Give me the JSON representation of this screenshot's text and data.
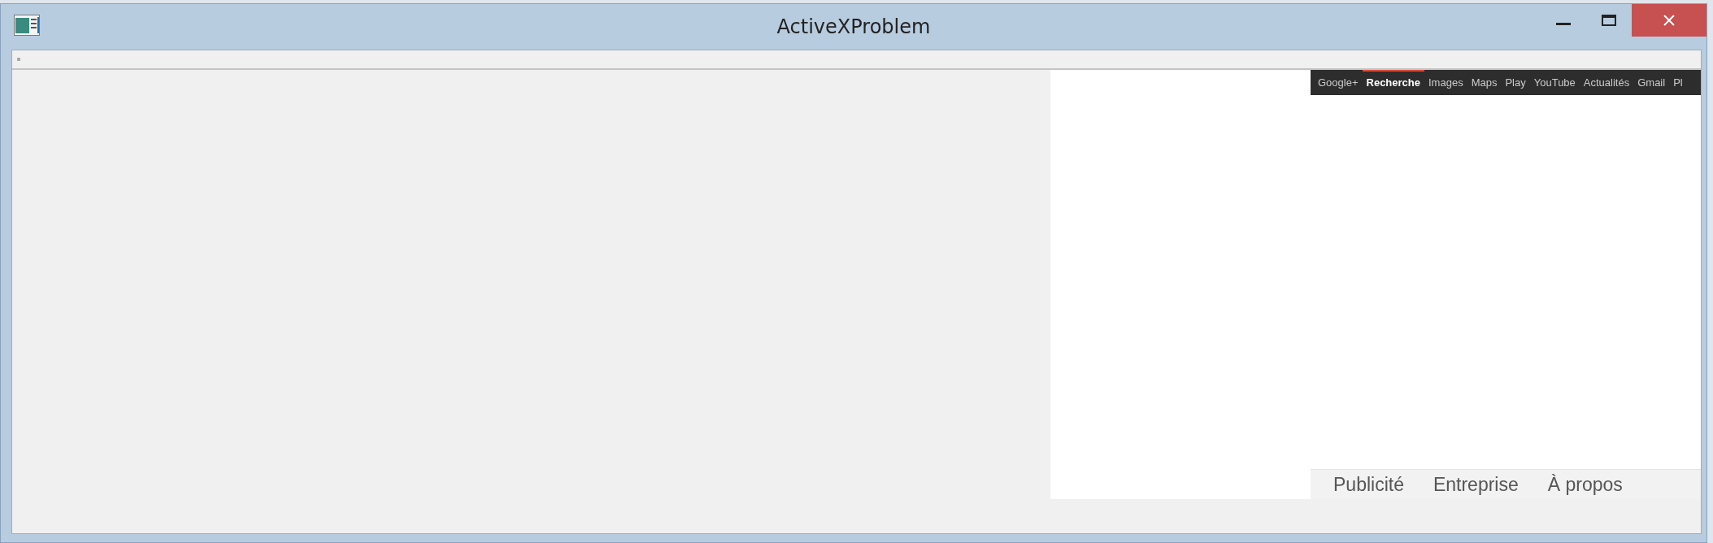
{
  "window": {
    "title": "ActiveXProblem"
  },
  "browser": {
    "nav": [
      {
        "label": "Google+",
        "selected": false
      },
      {
        "label": "Recherche",
        "selected": true
      },
      {
        "label": "Images",
        "selected": false
      },
      {
        "label": "Maps",
        "selected": false
      },
      {
        "label": "Play",
        "selected": false
      },
      {
        "label": "YouTube",
        "selected": false
      },
      {
        "label": "Actualités",
        "selected": false
      },
      {
        "label": "Gmail",
        "selected": false
      },
      {
        "label": "Pl",
        "selected": false
      }
    ],
    "footer": [
      "Publicité",
      "Entreprise",
      "À propos"
    ]
  }
}
